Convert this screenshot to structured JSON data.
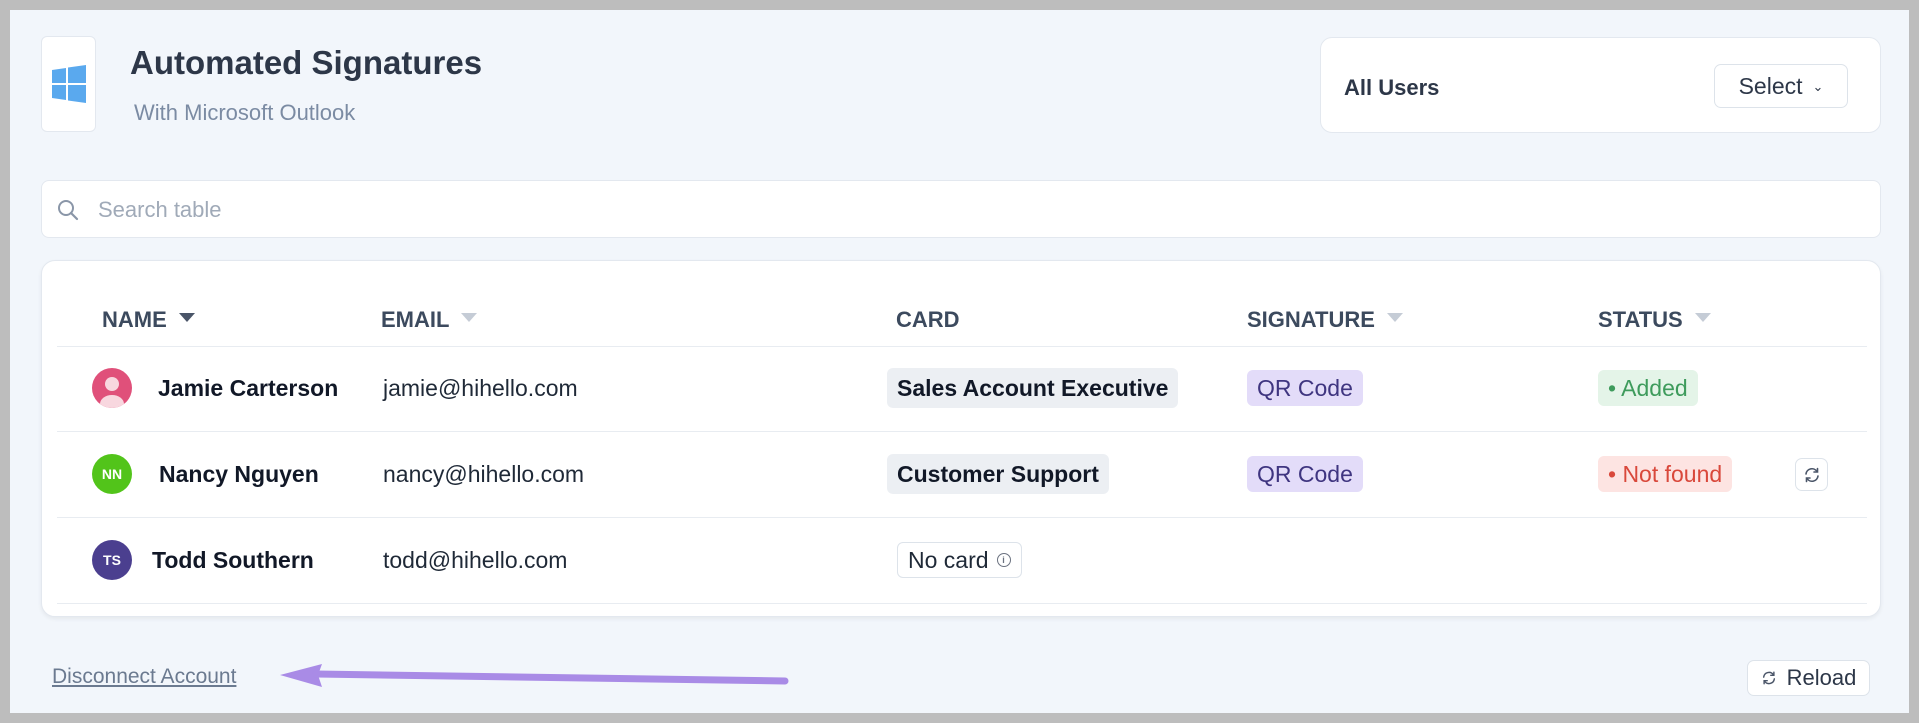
{
  "header": {
    "title": "Automated Signatures",
    "subtitle": "With Microsoft Outlook",
    "logo_icon": "windows-logo-icon",
    "logo_color": "#5aa9ee"
  },
  "users_filter": {
    "label": "All Users",
    "select_label": "Select"
  },
  "search": {
    "placeholder": "Search table",
    "value": ""
  },
  "table": {
    "columns": [
      "NAME",
      "EMAIL",
      "CARD",
      "SIGNATURE",
      "STATUS"
    ],
    "rows": [
      {
        "initials": "",
        "avatar_color": "#e0507a",
        "name": "Jamie Carterson",
        "email": "jamie@hihello.com",
        "card": "Sales Account Executive",
        "signature": "QR Code",
        "status": "• Added",
        "status_color": "#3e9b5c"
      },
      {
        "initials": "NN",
        "avatar_color": "#52c41a",
        "name": "Nancy Nguyen",
        "email": "nancy@hihello.com",
        "card": "Customer Support",
        "signature": "QR Code",
        "status": "• Not found",
        "status_color": "#d9483b"
      },
      {
        "initials": "TS",
        "avatar_color": "#4b3f8f",
        "name": "Todd Southern",
        "email": "todd@hihello.com",
        "card": "No card",
        "signature": "",
        "status": ""
      }
    ]
  },
  "footer": {
    "disconnect_label": "Disconnect Account",
    "reload_label": "Reload",
    "annotation_arrow_color": "#a98be6"
  }
}
